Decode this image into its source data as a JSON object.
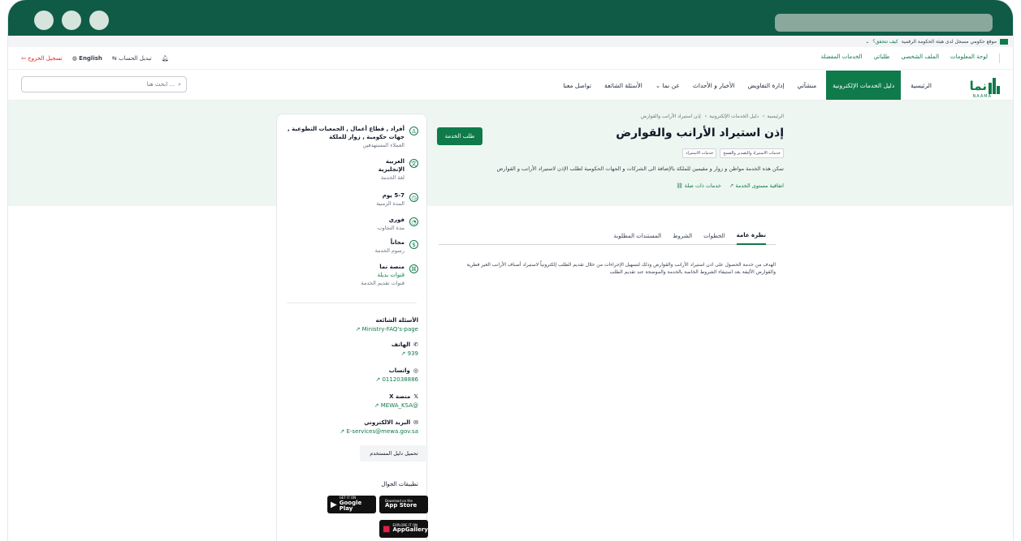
{
  "gov_strip": {
    "text": "موقع حكومي مسجل لدى هيئة الحكومة الرقمية",
    "how_to_verify": "كيف تتحقق؟"
  },
  "topbar": {
    "right_links": [
      "لوحة المعلومات",
      "الملف الشخصي",
      "طلباتي",
      "الخدمات المفضلة"
    ],
    "switch_account": "تبديل الحساب",
    "language": "English",
    "logout": "تسجيل الخروج"
  },
  "nav": {
    "logo_text": "نما",
    "logo_sub": "NAAMA",
    "items": [
      {
        "label": "الرئيسية",
        "active": false
      },
      {
        "label": "دليل الخدمات الإلكترونية",
        "active": true
      },
      {
        "label": "منشآتي",
        "active": false
      },
      {
        "label": "إدارة التفاويض",
        "active": false
      },
      {
        "label": "الأخبار و الأحداث",
        "active": false
      },
      {
        "label": "عن نما",
        "active": false
      },
      {
        "label": "الأسئلة الشائعة",
        "active": false
      },
      {
        "label": "تواصل معنا",
        "active": false
      }
    ],
    "search_placeholder": "ابحث هنا ..."
  },
  "hero": {
    "breadcrumbs": [
      "الرئيسية",
      "دليل الخدمات الإلكترونية",
      "إذن استيراد الأرانب والقوارض"
    ],
    "title": "إذن استيراد الأرانب والقوارض",
    "tags": [
      "خدمات الاستيراد والتصدير والفسح",
      "خدمات الاستيراد"
    ],
    "description": "تمكن هذه الخدمة مواطن و زوار و مقيمين للملكة بالإضافة الى الشركات و الجهات الحكومية لطلب الإذن لاستيراد الأرانب و القوارض",
    "link_sla": "اتفاقية مستوى الخدمة",
    "link_related": "خدمات ذات صلة",
    "request_button": "طلب الخدمة"
  },
  "meta": {
    "beneficiaries": "أفراد , قطاع أعمال , الجمعيات التطوعية , جهات حكومية , زوار للملكة",
    "beneficiaries_label": "العملاء المستهدفين",
    "languages_1": "العربية",
    "languages_2": "الإنجليزية",
    "languages_label": "لغة الخدمة",
    "duration": "5-7 يوم",
    "duration_label": "المدة الزمنية",
    "response": "فوري",
    "response_label": "مدة التجاوب",
    "fees": "مجاناً",
    "fees_label": "رسوم الخدمة",
    "channel": "منصة نما",
    "channel_alt": "قنوات بديلة",
    "channel_label": "قنوات تقديم الخدمة"
  },
  "contact": {
    "faq_label": "الأسئلة الشائعة",
    "faq_value": "Ministry-FAQ's-page",
    "phone_label": "الهاتف",
    "phone_value": "939",
    "whatsapp_label": "واتساب",
    "whatsapp_value": "0112038886",
    "x_label": "منصة X",
    "x_value": "@MEWA_KSA",
    "email_label": "البريد الالكتروني",
    "email_value": "E-services@mewa.gov.sa",
    "user_guide": "تحميل دليل المستخدم"
  },
  "apps": {
    "title": "تطبيقات الجوال",
    "google_small": "GET IT ON",
    "google_big": "Google Play",
    "apple_small": "Download on the",
    "apple_big": "App Store",
    "huawei_small": "EXPLORE IT ON",
    "huawei_big": "AppGallery"
  },
  "tabs": {
    "items": [
      "نظرة عامة",
      "الخطوات",
      "الشروط",
      "المستندات المطلوبة"
    ],
    "overview_text": "الهدف من خدمة الحصول على اذن استيراد الأرانب والقوارض وذلك لتسهيل الإجراءات من خلال تقديم الطلب إلكترونياً لاستيراد أصناف الأرانب الغير فطرية والقوارض الأليفة بعد استيفاء الشروط الخاصة بالخدمة والموضحة عند تقديم الطلب"
  },
  "colors": {
    "brand": "#0f7a4a",
    "hero_bg": "#eef6f1",
    "chrome": "#0f5b46"
  }
}
